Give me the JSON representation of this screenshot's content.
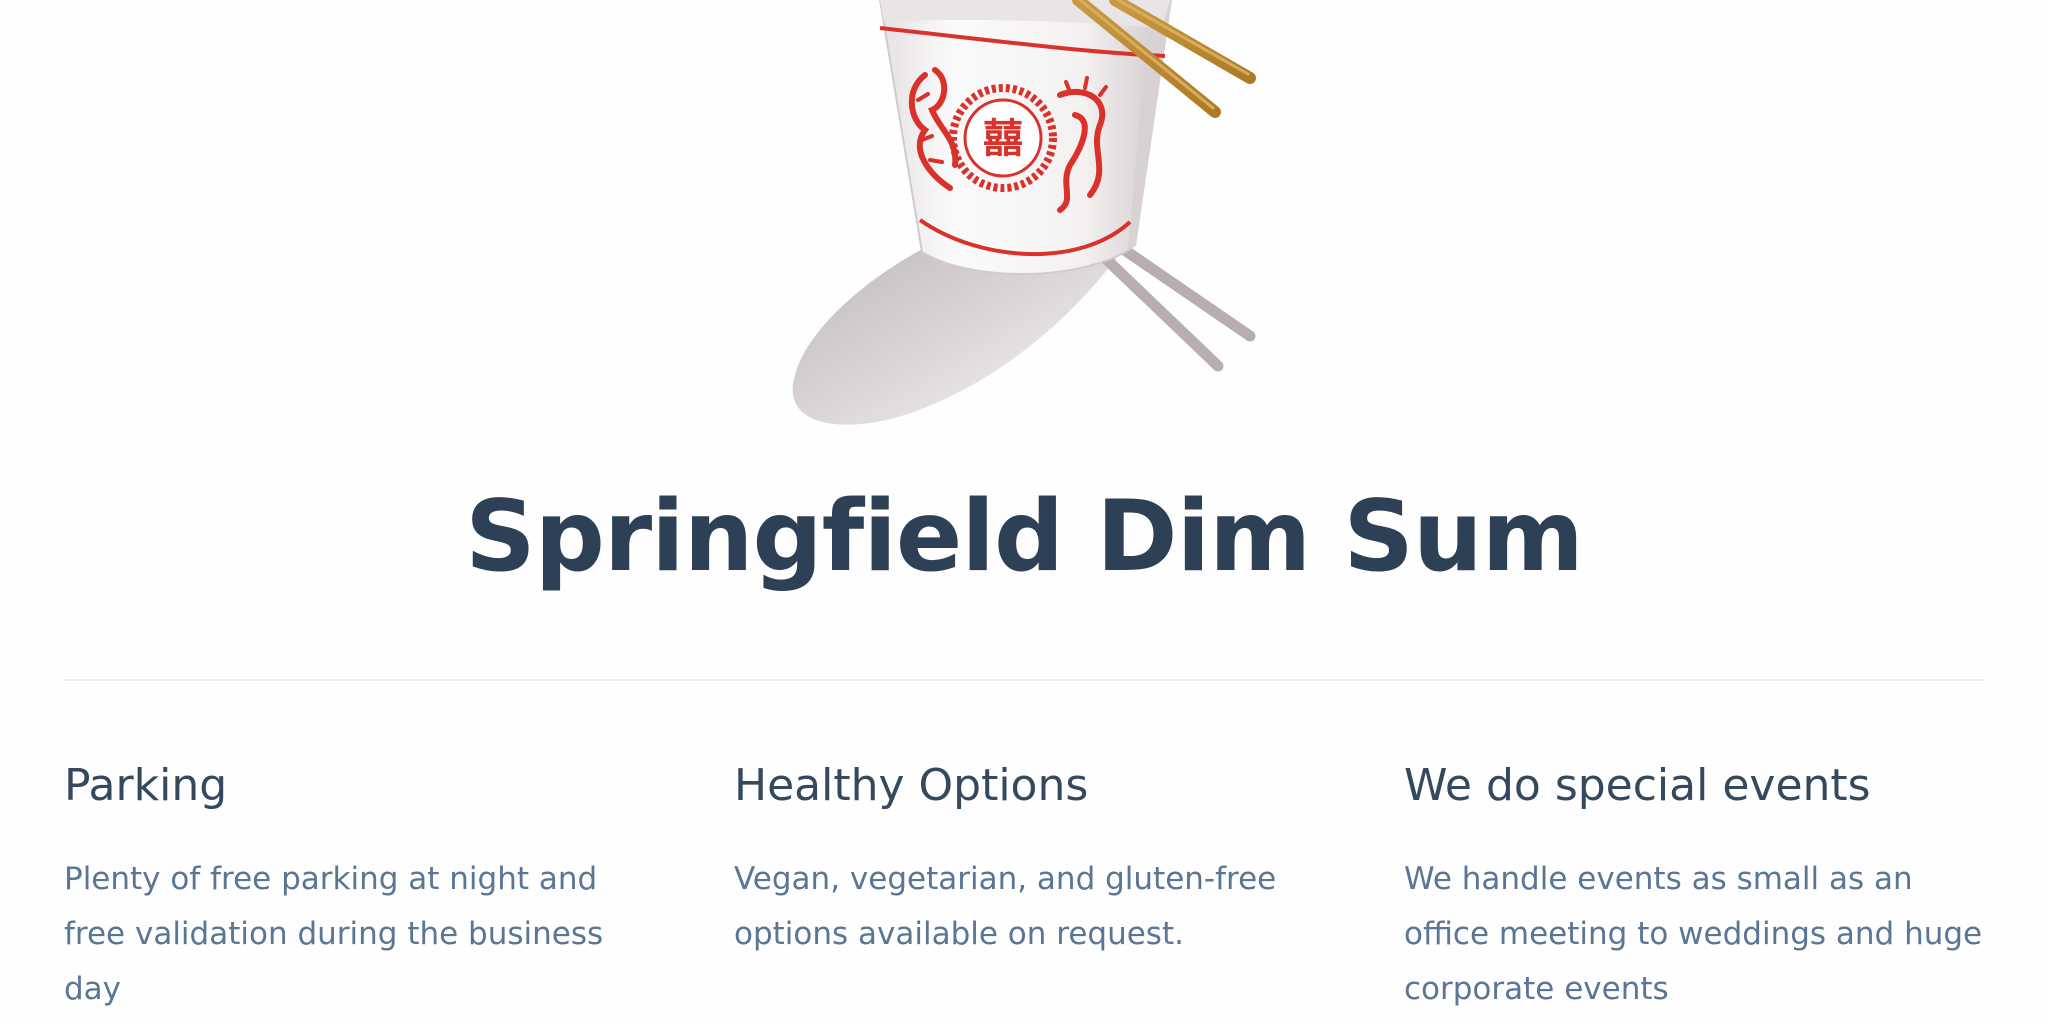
{
  "hero": {
    "illustration_icon": "takeout-box-with-chopsticks-icon",
    "emblem_glyph": "囍",
    "colors": {
      "box_red": "#d8322a",
      "chopsticks": "#c08a2f",
      "shadow": "#cfc9cc"
    }
  },
  "site": {
    "title": "Springfield Dim Sum"
  },
  "features": [
    {
      "title": "Parking",
      "text": "Plenty of free parking at night and free validation during the business day"
    },
    {
      "title": "Healthy Options",
      "text": "Vegan, vegetarian, and gluten-free options available on request."
    },
    {
      "title": "We do special events",
      "text": "We handle events as small as an office meeting to weddings and huge corporate events"
    }
  ],
  "colors": {
    "title": "#2e4055",
    "feature_title": "#34495e",
    "feature_text": "#5a7694",
    "divider": "#eceff2",
    "background": "#fefefe"
  }
}
